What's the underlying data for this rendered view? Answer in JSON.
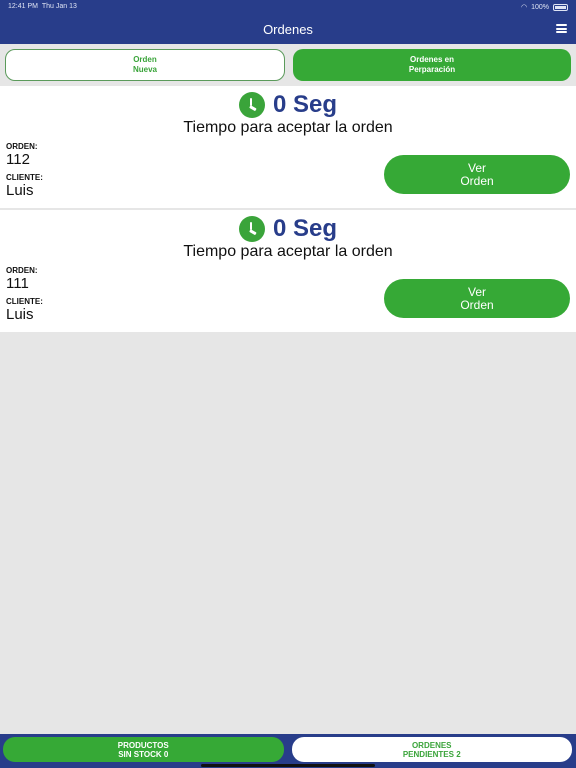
{
  "status_bar": {
    "time": "12:41 PM",
    "date": "Thu Jan 13",
    "battery": "100%"
  },
  "header": {
    "title": "Ordenes"
  },
  "tabs": [
    {
      "label": "Orden\nNueva",
      "active": false
    },
    {
      "label": "Ordenes en\nPerparación",
      "active": true
    }
  ],
  "orders": [
    {
      "timer": "0 Seg",
      "timer_caption": "Tiempo para aceptar la orden",
      "order_label": "ORDEN:",
      "order_number": "112",
      "client_label": "CLIENTE:",
      "client_name": "Luis",
      "button_label": "Ver\nOrden"
    },
    {
      "timer": "0 Seg",
      "timer_caption": "Tiempo para aceptar la orden",
      "order_label": "ORDEN:",
      "order_number": "111",
      "client_label": "CLIENTE:",
      "client_name": "Luis",
      "button_label": "Ver\nOrden"
    }
  ],
  "bottom_tabs": [
    {
      "label": "PRODUCTOS\nSIN STOCK 0",
      "active": true
    },
    {
      "label": "ORDENES\nPENDIENTES 2",
      "active": false
    }
  ],
  "colors": {
    "primary": "#283d8a",
    "accent_green": "#36a936",
    "background": "#e6e6e6"
  }
}
